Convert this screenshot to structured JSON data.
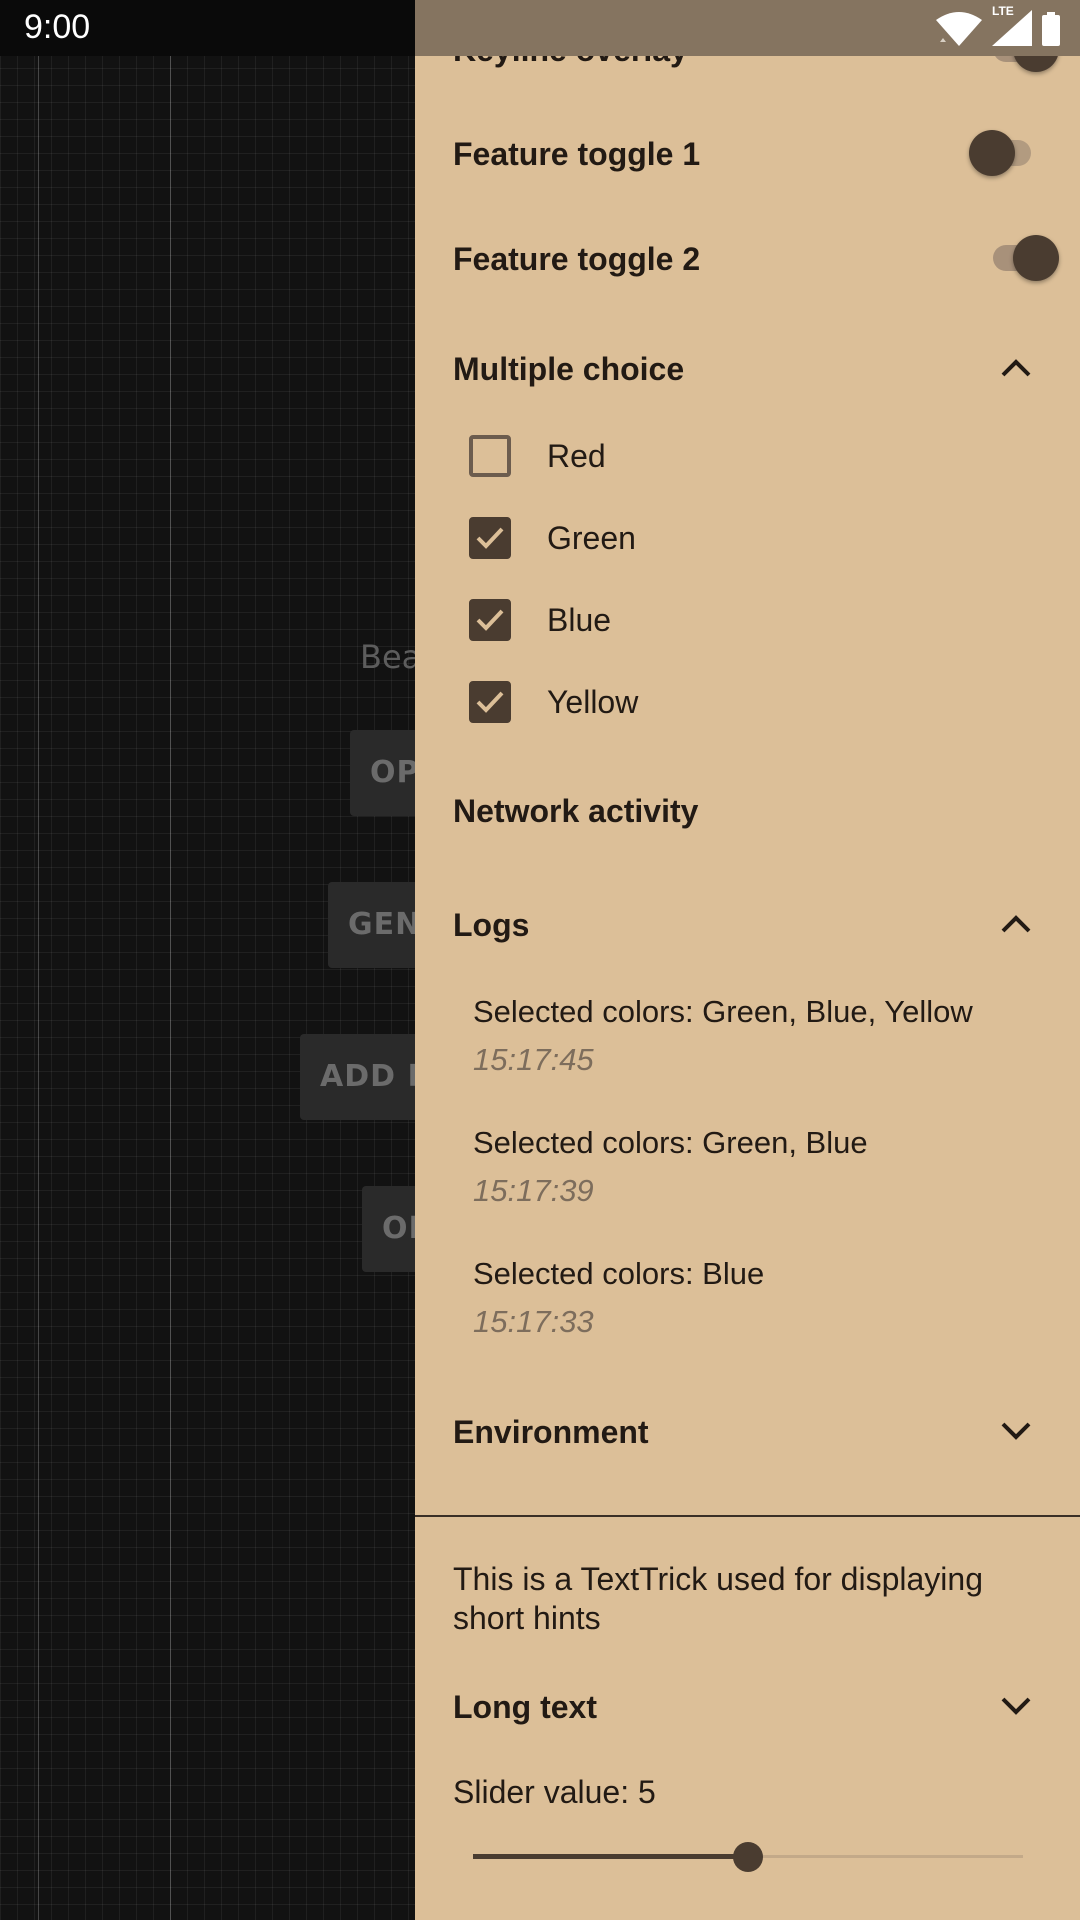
{
  "status_bar": {
    "time": "9:00",
    "network_label": "LTE",
    "icons": [
      "wifi-icon",
      "cell-signal-icon",
      "battery-icon"
    ]
  },
  "background_app": {
    "partial_text": "Bea",
    "buttons": [
      "OP",
      "GEN",
      "ADD R",
      "OF"
    ]
  },
  "drawer": {
    "toggles": [
      {
        "label": "Keyline overlay",
        "on": true
      },
      {
        "label": "Feature toggle 1",
        "on": false
      },
      {
        "label": "Feature toggle 2",
        "on": true
      }
    ],
    "multiple_choice": {
      "title": "Multiple choice",
      "expanded": true,
      "options": [
        {
          "label": "Red",
          "checked": false
        },
        {
          "label": "Green",
          "checked": true
        },
        {
          "label": "Blue",
          "checked": true
        },
        {
          "label": "Yellow",
          "checked": true
        }
      ]
    },
    "network_activity": {
      "title": "Network activity"
    },
    "logs": {
      "title": "Logs",
      "expanded": true,
      "entries": [
        {
          "message": "Selected colors: Green, Blue, Yellow",
          "time": "15:17:45"
        },
        {
          "message": "Selected colors: Green, Blue",
          "time": "15:17:39"
        },
        {
          "message": "Selected colors: Blue",
          "time": "15:17:33"
        }
      ]
    },
    "environment": {
      "title": "Environment",
      "expanded": false
    },
    "hint": "This is a TextTrick used for displaying short hints",
    "long_text": {
      "title": "Long text",
      "expanded": false
    },
    "slider": {
      "label": "Slider value: 5",
      "value": 5,
      "min": 0,
      "max": 10
    }
  },
  "colors": {
    "drawer_bg": "#dcbf98",
    "accent": "#4a3c30",
    "text_primary": "#221a14",
    "text_secondary": "#7d6d5c"
  }
}
